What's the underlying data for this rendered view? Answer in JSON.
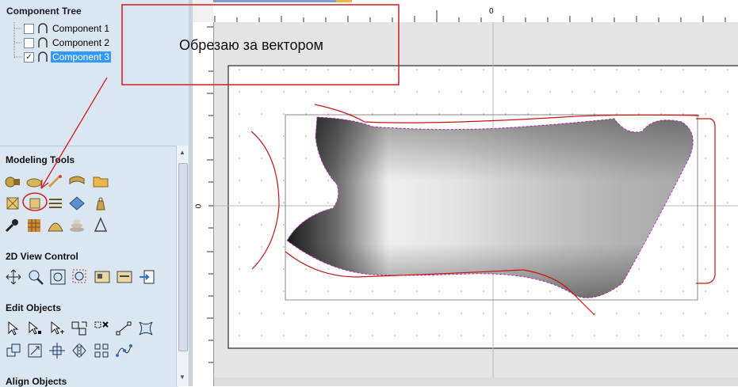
{
  "component_tree": {
    "title": "Component Tree",
    "items": [
      {
        "label": "Component 1",
        "checked": false,
        "selected": false
      },
      {
        "label": "Component 2",
        "checked": false,
        "selected": false
      },
      {
        "label": "Component 3",
        "checked": true,
        "selected": true
      }
    ]
  },
  "panels": {
    "modeling_tools": "Modeling Tools",
    "view_control": "2D View Control",
    "edit_objects": "Edit Objects",
    "align_objects": "Align Objects"
  },
  "ruler": {
    "top_zero": "0",
    "left_zero": "0"
  },
  "annotation": {
    "text": "Обрезаю за вектором",
    "color": "#d81b1b"
  },
  "colors": {
    "panel_bg": "#dbe6f3",
    "selection": "#3399ff",
    "vector_red": "#c81414",
    "boundary_magenta": "#cc33cc"
  }
}
